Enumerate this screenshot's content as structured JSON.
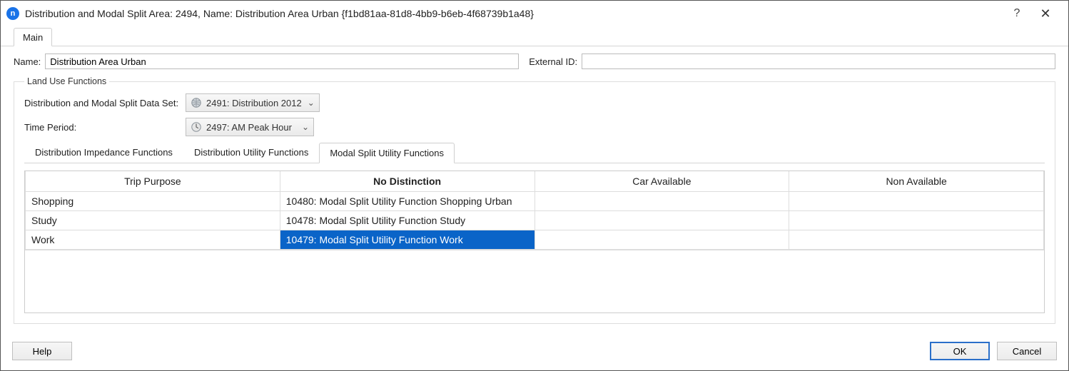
{
  "window": {
    "title": "Distribution and Modal Split Area: 2494, Name: Distribution Area Urban  {f1bd81aa-81d8-4bb9-b6eb-4f68739b1a48}",
    "app_icon_glyph": "n"
  },
  "top_tabs": {
    "main": "Main"
  },
  "fields": {
    "name_label": "Name:",
    "name_value": "Distribution Area Urban",
    "extid_label": "External ID:",
    "extid_value": ""
  },
  "fieldset": {
    "legend": "Land Use Functions",
    "dataset_label": "Distribution and Modal Split Data Set:",
    "dataset_value": "2491: Distribution 2012",
    "timeperiod_label": "Time Period:",
    "timeperiod_value": "2497: AM Peak Hour"
  },
  "inner_tabs": {
    "t1": "Distribution Impedance Functions",
    "t2": "Distribution Utility Functions",
    "t3": "Modal Split Utility Functions"
  },
  "table": {
    "headers": {
      "trip_purpose": "Trip Purpose",
      "no_distinction": "No Distinction",
      "car_available": "Car Available",
      "non_available": "Non Available"
    },
    "rows": [
      {
        "purpose": "Shopping",
        "no_distinction": "10480: Modal Split Utility Function Shopping Urban",
        "car": "",
        "non": "",
        "selected": false
      },
      {
        "purpose": "Study",
        "no_distinction": "10478: Modal Split Utility Function Study",
        "car": "",
        "non": "",
        "selected": false
      },
      {
        "purpose": "Work",
        "no_distinction": "10479: Modal Split Utility Function Work",
        "car": "",
        "non": "",
        "selected": true
      }
    ]
  },
  "buttons": {
    "help": "Help",
    "ok": "OK",
    "cancel": "Cancel"
  }
}
